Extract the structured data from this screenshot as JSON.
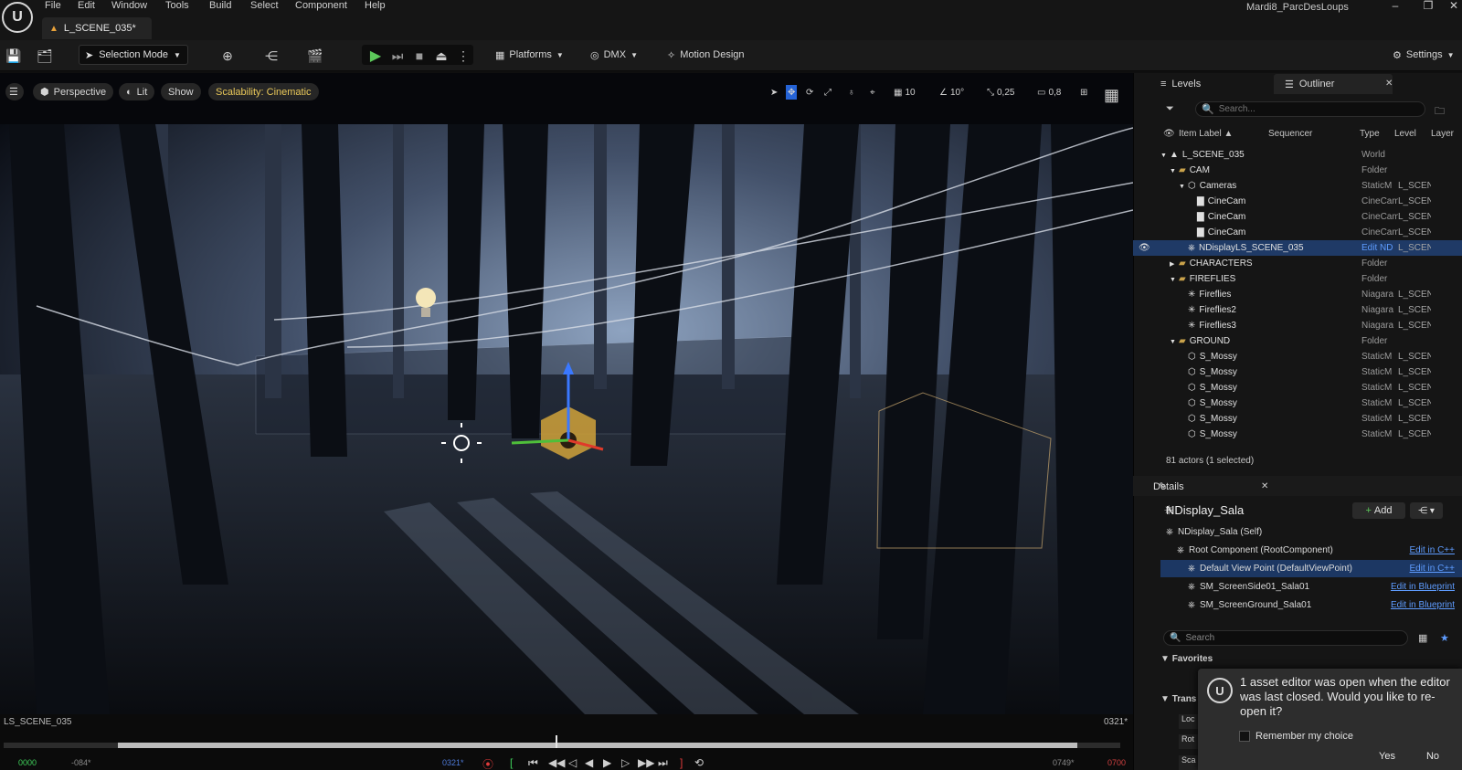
{
  "app": {
    "logo_letter": "U",
    "menu": [
      "File",
      "Edit",
      "Window",
      "Tools",
      "Build",
      "Select",
      "Component",
      "Help"
    ],
    "doc_tab": "L_SCENE_035*",
    "project_name": "Mardi8_ParcDesLoups"
  },
  "toolbar": {
    "selection_mode": "Selection Mode",
    "platforms": "Platforms",
    "dmx": "DMX",
    "motion_design": "Motion Design",
    "settings": "Settings"
  },
  "viewport": {
    "perspective": "Perspective",
    "lit": "Lit",
    "show": "Show",
    "scalability": "Scalability: Cinematic",
    "grid": "10",
    "angle": "10°",
    "scale": "0,25",
    "camera_speed": "0,8",
    "scene_label": "LS_SCENE_035",
    "frame_label": "0321*"
  },
  "timeline": {
    "start": "0000",
    "start_offset": "-084*",
    "current": "0321*",
    "end_offset": "0749*",
    "end": "0700"
  },
  "outliner": {
    "tab_levels": "Levels",
    "tab_outliner": "Outliner",
    "search_placeholder": "Search...",
    "columns": [
      "Item Label ▲",
      "Sequencer",
      "Type",
      "Level",
      "Layer"
    ],
    "rows": [
      {
        "label": "L_SCENE_035",
        "type": "World",
        "level": "",
        "indent": 0,
        "icon": "level-icon",
        "expand": "▼"
      },
      {
        "label": "CAM",
        "type": "Folder",
        "level": "",
        "indent": 1,
        "icon": "folder-icon",
        "expand": "▼"
      },
      {
        "label": "Cameras",
        "type": "StaticM",
        "level": "L_SCENE",
        "indent": 2,
        "icon": "mesh-icon",
        "expand": "▼"
      },
      {
        "label": "CineCam",
        "type": "CineCam",
        "level": "L_SCENE",
        "indent": 3,
        "icon": "camera-icon",
        "expand": ""
      },
      {
        "label": "CineCam",
        "type": "CineCam",
        "level": "L_SCENE",
        "indent": 3,
        "icon": "camera-icon",
        "expand": ""
      },
      {
        "label": "CineCam",
        "type": "CineCam",
        "level": "L_SCENE",
        "indent": 3,
        "icon": "camera-icon",
        "expand": ""
      },
      {
        "label": "NDisplayLS_SCENE_035",
        "type": "Edit ND",
        "level": "L_SCENE",
        "indent": 2,
        "icon": "ndisplay-icon",
        "expand": "",
        "selected": true
      },
      {
        "label": "CHARACTERS",
        "type": "Folder",
        "level": "",
        "indent": 1,
        "icon": "folder-icon",
        "expand": "▶"
      },
      {
        "label": "FIREFLIES",
        "type": "Folder",
        "level": "",
        "indent": 1,
        "icon": "folder-icon",
        "expand": "▼"
      },
      {
        "label": "Fireflies",
        "type": "Niagara",
        "level": "L_SCENE",
        "indent": 2,
        "icon": "niagara-icon",
        "expand": ""
      },
      {
        "label": "Fireflies2",
        "type": "Niagara",
        "level": "L_SCENE",
        "indent": 2,
        "icon": "niagara-icon",
        "expand": ""
      },
      {
        "label": "Fireflies3",
        "type": "Niagara",
        "level": "L_SCENE",
        "indent": 2,
        "icon": "niagara-icon",
        "expand": ""
      },
      {
        "label": "GROUND",
        "type": "Folder",
        "level": "",
        "indent": 1,
        "icon": "folder-icon",
        "expand": "▼"
      },
      {
        "label": "S_Mossy",
        "type": "StaticM",
        "level": "L_SCENE",
        "indent": 2,
        "icon": "mesh-icon",
        "expand": ""
      },
      {
        "label": "S_Mossy",
        "type": "StaticM",
        "level": "L_SCENE",
        "indent": 2,
        "icon": "mesh-icon",
        "expand": ""
      },
      {
        "label": "S_Mossy",
        "type": "StaticM",
        "level": "L_SCENE",
        "indent": 2,
        "icon": "mesh-icon",
        "expand": ""
      },
      {
        "label": "S_Mossy",
        "type": "StaticM",
        "level": "L_SCENE",
        "indent": 2,
        "icon": "mesh-icon",
        "expand": ""
      },
      {
        "label": "S_Mossy",
        "type": "StaticM",
        "level": "L_SCENE",
        "indent": 2,
        "icon": "mesh-icon",
        "expand": ""
      },
      {
        "label": "S_Mossy",
        "type": "StaticM",
        "level": "L_SCENE",
        "indent": 2,
        "icon": "mesh-icon",
        "expand": ""
      }
    ],
    "actors_count": "81 actors (1 selected)"
  },
  "details": {
    "tab": "Details",
    "actor_name": "NDisplay_Sala",
    "add_label": "Add",
    "components": [
      {
        "label": "NDisplay_Sala (Self)",
        "edit": "",
        "indent": 0
      },
      {
        "label": "Root Component (RootComponent)",
        "edit": "Edit in C++",
        "indent": 1
      },
      {
        "label": "Default View Point (DefaultViewPoint)",
        "edit": "Edit in C++",
        "indent": 2,
        "selected": true
      },
      {
        "label": "SM_ScreenSide01_Sala01",
        "edit": "Edit in Blueprint",
        "indent": 2
      },
      {
        "label": "SM_ScreenGround_Sala01",
        "edit": "Edit in Blueprint",
        "indent": 2
      }
    ],
    "search_placeholder": "Search",
    "favorites": "Favorites",
    "transform": "Trans",
    "rows": [
      "Loc",
      "Rot",
      "Sca"
    ]
  },
  "notification": {
    "text": "1 asset editor was open when the editor was last closed. Would you like to re-open it?",
    "remember": "Remember my choice",
    "yes": "Yes",
    "no": "No"
  }
}
